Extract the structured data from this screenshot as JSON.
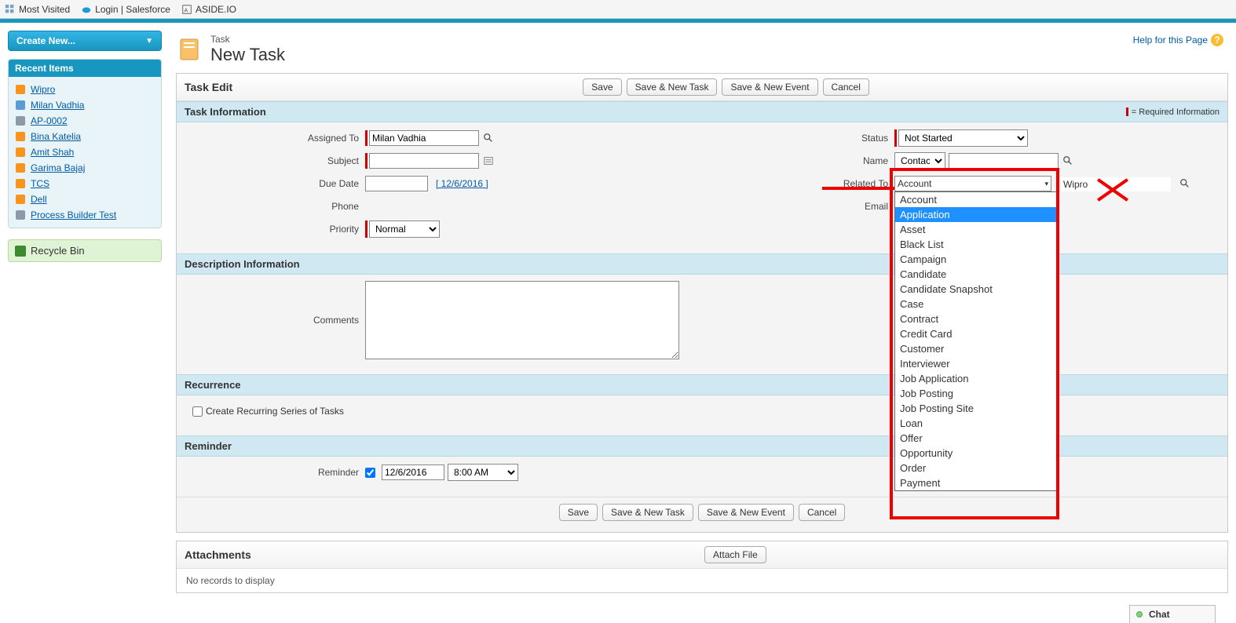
{
  "bookmarks": {
    "most_visited": "Most Visited",
    "login_sf": "Login | Salesforce",
    "aside": "ASIDE.IO"
  },
  "sidebar": {
    "create_new": "Create New...",
    "recent_title": "Recent Items",
    "items": [
      "Wipro",
      "Milan Vadhia",
      "AP-0002",
      "Bina Katelia",
      "Amit Shah",
      "Garima Bajaj",
      "TCS",
      "Dell",
      "Process Builder Test"
    ],
    "recycle": "Recycle Bin"
  },
  "page": {
    "object": "Task",
    "title": "New Task",
    "help": "Help for this Page"
  },
  "edit_title": "Task Edit",
  "buttons": {
    "save": "Save",
    "save_new_task": "Save & New Task",
    "save_new_event": "Save & New Event",
    "cancel": "Cancel",
    "attach": "Attach File"
  },
  "sections": {
    "task_info": "Task Information",
    "req_info": "= Required Information",
    "desc_info": "Description Information",
    "recurrence": "Recurrence",
    "reminder": "Reminder",
    "attachments": "Attachments"
  },
  "labels": {
    "assigned_to": "Assigned To",
    "subject": "Subject",
    "due_date": "Due Date",
    "phone": "Phone",
    "priority": "Priority",
    "status": "Status",
    "name": "Name",
    "related_to": "Related To",
    "email": "Email",
    "comments": "Comments",
    "recurrence_cb": "Create Recurring Series of Tasks",
    "reminder": "Reminder"
  },
  "values": {
    "assigned_to": "Milan Vadhia",
    "subject": "",
    "due_date": "",
    "due_date_link": "[ 12/6/2016 ]",
    "priority": "Normal",
    "status": "Not Started",
    "name_type": "Contact",
    "name_val": "",
    "related_to_type": "Account",
    "related_to_val": "Wipro",
    "reminder_checked": true,
    "reminder_date": "12/6/2016",
    "reminder_time": "8:00 AM",
    "no_records": "No records to display"
  },
  "related_to_options": [
    "Account",
    "Application",
    "Asset",
    "Black List",
    "Campaign",
    "Candidate",
    "Candidate Snapshot",
    "Case",
    "Contract",
    "Credit Card",
    "Customer",
    "Interviewer",
    "Job Application",
    "Job Posting",
    "Job Posting Site",
    "Loan",
    "Offer",
    "Opportunity",
    "Order",
    "Payment"
  ],
  "related_highlighted": "Application",
  "chat": "Chat"
}
